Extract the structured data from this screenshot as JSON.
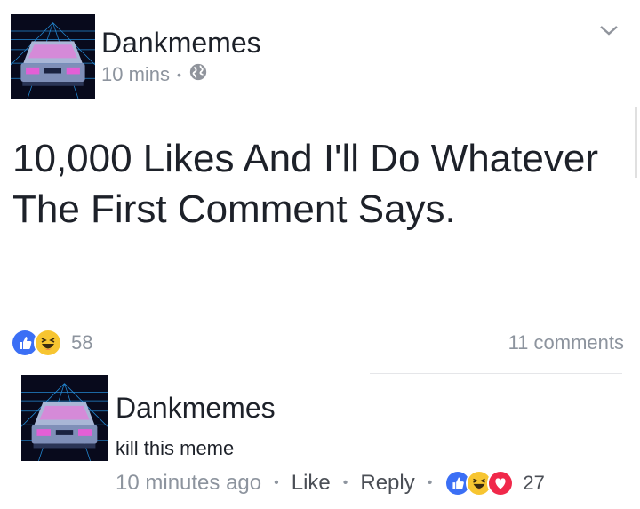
{
  "post": {
    "author": "Dankmemes",
    "time": "10 mins",
    "text": "10,000 Likes And I'll Do Whatever The First Comment Says.",
    "reaction_count": "58",
    "comments_count": "11 comments"
  },
  "comment": {
    "author": "Dankmemes",
    "text": "kill this meme",
    "time": "10 minutes ago",
    "like_label": "Like",
    "reply_label": "Reply",
    "reaction_count": "27"
  },
  "icons": {
    "privacy": "globe-icon",
    "menu": "chevron-down-icon",
    "reactions_post": [
      "like-reaction-icon",
      "haha-reaction-icon"
    ],
    "reactions_comment": [
      "like-reaction-icon",
      "haha-reaction-icon",
      "love-reaction-icon"
    ]
  },
  "colors": {
    "like_blue": "#3b6ff5",
    "haha_yellow": "#f7c531",
    "love_red": "#f0284a",
    "muted_text": "#8d949e"
  }
}
